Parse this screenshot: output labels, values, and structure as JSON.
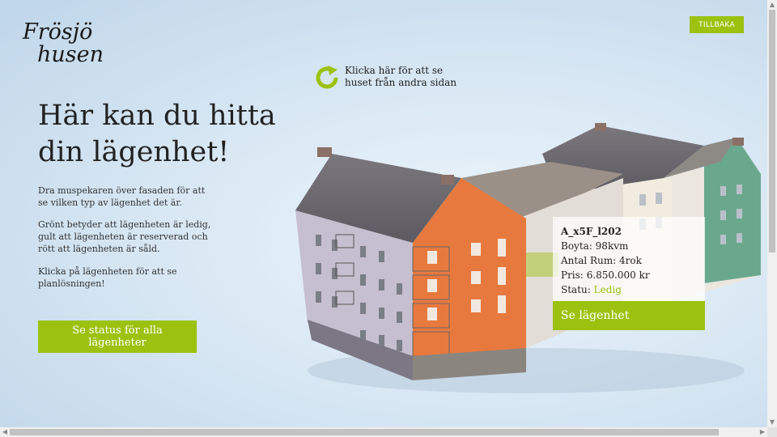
{
  "logo": {
    "line1": "Frösjö",
    "line2": "husen"
  },
  "nav": {
    "back_label": "TILLBAKA"
  },
  "rotate": {
    "text": "Klicka här för att se huset från andra sidan",
    "icon": "rotate-arrow-icon"
  },
  "intro": {
    "heading": "Här kan du hitta din lägenhet!",
    "p1": "Dra muspekaren över fasaden för att se vilken typ av lägenhet det är.",
    "p2": "Grönt betyder att lägenheten är ledig, gult att lägenheten är reserverad och rött att lägenheten är såld.",
    "p3": "Klicka på lägenheten för att se planlösningen!",
    "status_button": "Se status för alla lägenheter"
  },
  "apartment": {
    "id": "A_x5F_l202",
    "area_label": "Boyta:",
    "area": "98kvm",
    "rooms_label": "Antal Rum:",
    "rooms": "4rok",
    "price_label": "Pris:",
    "price": "6.850.000 kr",
    "status_label": "Statu:",
    "status": "Ledig",
    "button": "Se lägenhet"
  },
  "colors": {
    "accent": "#9cc20f",
    "facade_orange": "#e8793e",
    "facade_green": "#6aa88e",
    "facade_cream": "#f2ece0",
    "facade_lilac": "#c6bfd0",
    "roof": "#6e6b70"
  }
}
